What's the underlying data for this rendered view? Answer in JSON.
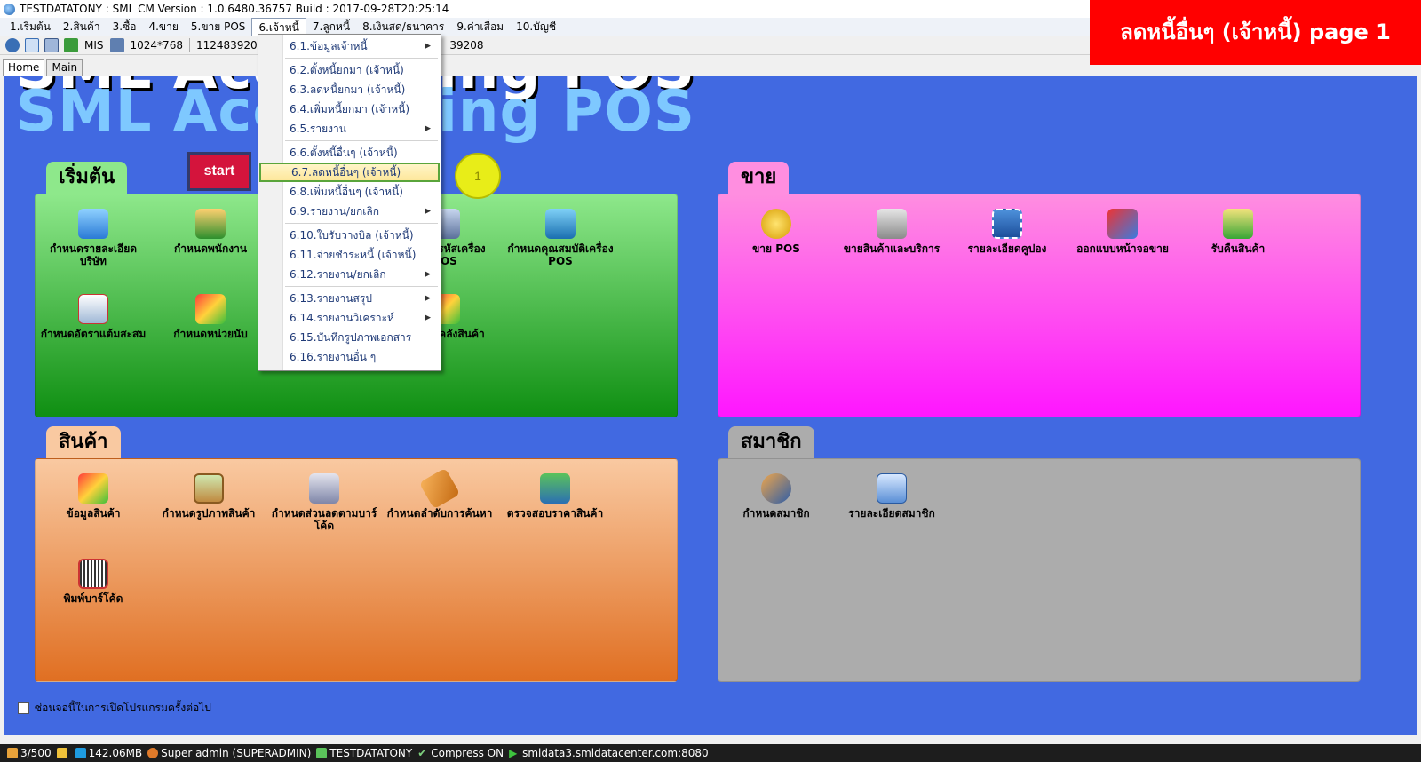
{
  "window": {
    "title": "TESTDATATONY : SML CM Version : 1.0.6480.36757  Build : 2017-09-28T20:25:14"
  },
  "menubar": {
    "items": [
      "1.เริ่มต้น",
      "2.สินค้า",
      "3.ซื้อ",
      "4.ขาย",
      "5.ขาย POS",
      "6.เจ้าหนี้",
      "7.ลูกหนี้",
      "8.เงินสด/ธนาคาร",
      "9.ค่าเสื่อม",
      "10.บัญชี"
    ]
  },
  "toolbar": {
    "mis_label": "MIS",
    "resolution": "1024*768",
    "id_left": "1124839208",
    "id_right": "39208"
  },
  "tabs": [
    "Home",
    "Main"
  ],
  "logo": {
    "text": "SML Accounting POS"
  },
  "start_button": "start",
  "panels": {
    "start": {
      "title": "เริ่มต้น",
      "tiles": [
        {
          "label": "กำหนดรายละเอียดบริษัท",
          "icon": "house-icon"
        },
        {
          "label": "กำหนดพนักงาน",
          "icon": "users-icon"
        },
        {
          "label": "กำหนดรหัสเครื่อง POS",
          "icon": "computer-icon"
        },
        {
          "label": "กำหนดคุณสมบัติเครื่อง POS",
          "icon": "pos-device-icon"
        },
        {
          "label": "กำหนดอัตราแต้มสะสม",
          "icon": "edit-document-icon"
        },
        {
          "label": "กำหนดหน่วยนับ",
          "icon": "boxes-icon"
        },
        {
          "label": "กำหนดคลังสินค้า",
          "icon": "warehouse-boxes-icon"
        }
      ]
    },
    "sell": {
      "title": "ขาย",
      "tiles": [
        {
          "label": "ขาย POS",
          "icon": "dollar-coin-icon"
        },
        {
          "label": "ขายสินค้าและบริการ",
          "icon": "calculator-icon"
        },
        {
          "label": "รายละเอียดคูปอง",
          "icon": "coupon-icon"
        },
        {
          "label": "ออกแบบหน้าจอขาย",
          "icon": "shapes-icon"
        },
        {
          "label": "รับคืนสินค้า",
          "icon": "return-box-icon"
        }
      ]
    },
    "goods": {
      "title": "สินค้า",
      "tiles": [
        {
          "label": "ข้อมูลสินค้า",
          "icon": "boxes-icon"
        },
        {
          "label": "กำหนดรูปภาพสินค้า",
          "icon": "picture-icon"
        },
        {
          "label": "กำหนดส่วนลดตามบาร์โค้ด",
          "icon": "barcode-printer-icon"
        },
        {
          "label": "กำหนดลำดับการค้นหา",
          "icon": "tag-icon"
        },
        {
          "label": "ตรวจสอบราคาสินค้า",
          "icon": "check-books-icon"
        },
        {
          "label": "พิมพ์บาร์โค้ด",
          "icon": "barcode-icon"
        }
      ]
    },
    "member": {
      "title": "สมาชิก",
      "tiles": [
        {
          "label": "กำหนดสมาชิก",
          "icon": "handshake-icon"
        },
        {
          "label": "รายละเอียดสมาชิก",
          "icon": "id-card-icon"
        }
      ]
    }
  },
  "dropdown": {
    "items": [
      {
        "label": "6.1.ข้อมูลเจ้าหนี้",
        "submenu": true
      },
      {
        "label": "6.2.ตั้งหนี้ยกมา (เจ้าหนี้)"
      },
      {
        "label": "6.3.ลดหนี้ยกมา (เจ้าหนี้)"
      },
      {
        "label": "6.4.เพิ่มหนี้ยกมา (เจ้าหนี้)"
      },
      {
        "label": "6.5.รายงาน",
        "submenu": true
      },
      {
        "label": "6.6.ตั้งหนี้อื่นๆ (เจ้าหนี้)"
      },
      {
        "label": "6.7.ลดหนี้อื่นๆ (เจ้าหนี้)",
        "highlighted": true
      },
      {
        "label": "6.8.เพิ่มหนี้อื่นๆ (เจ้าหนี้)"
      },
      {
        "label": "6.9.รายงาน/ยกเลิก",
        "submenu": true
      },
      {
        "label": "6.10.ใบรับวางบิล (เจ้าหนี้)"
      },
      {
        "label": "6.11.จ่ายชำระหนี้ (เจ้าหนี้)"
      },
      {
        "label": "6.12.รายงาน/ยกเลิก",
        "submenu": true
      },
      {
        "label": "6.13.รายงานสรุป",
        "submenu": true
      },
      {
        "label": "6.14.รายงานวิเคราะห์",
        "submenu": true
      },
      {
        "label": "6.15.บันทึกรูปภาพเอกสาร"
      },
      {
        "label": "6.16.รายงานอื่น ๆ"
      }
    ]
  },
  "callout": "1",
  "banner": "ลดหนี้อื่นๆ (เจ้าหนี้)  page 1",
  "dont_show_label": "ซ่อนจอนี้ในการเปิดโปรแกรมครั้งต่อไป",
  "statusbar": {
    "users": "3/500",
    "memory": "142.06MB",
    "user": "Super admin (SUPERADMIN)",
    "database": "TESTDATATONY",
    "compress": "Compress ON",
    "server": "smldata3.smldatacenter.com:8080"
  },
  "colors": {
    "main_bg": "#4169e1",
    "banner": "#ff0000",
    "start_button": "#d4143c",
    "callout": "#e8ed18"
  }
}
